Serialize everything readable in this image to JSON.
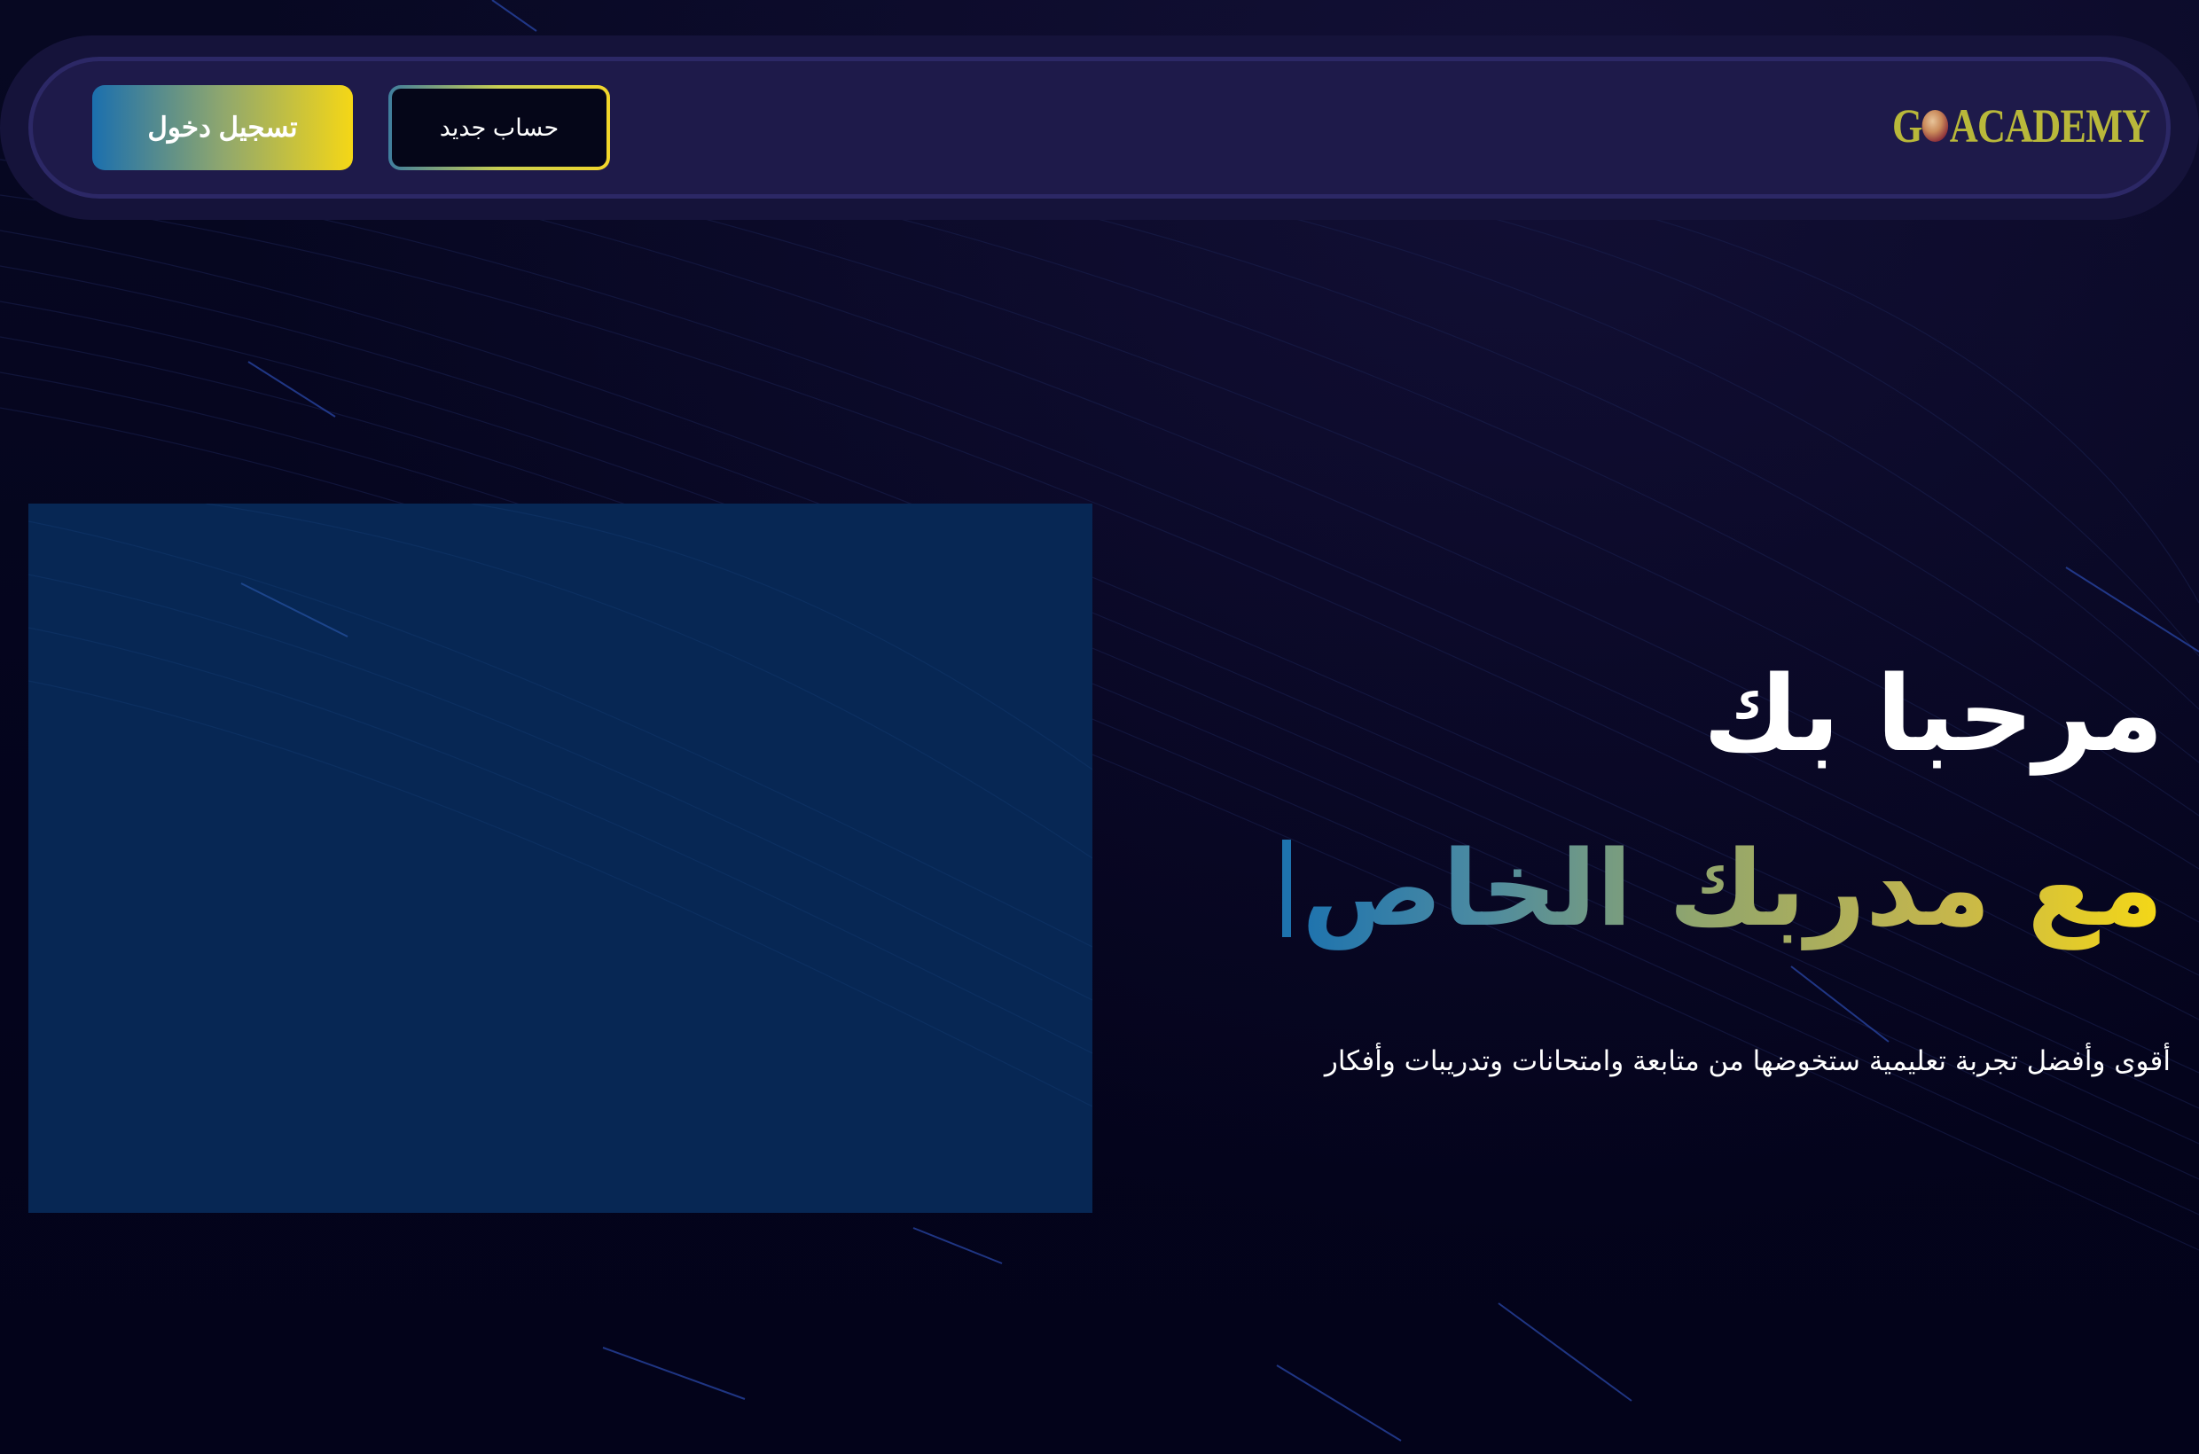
{
  "nav": {
    "logo_text": "GOACADEMY",
    "logo_left": "G",
    "logo_right": "ACADEMY",
    "login_label": "تسجيل دخول",
    "register_label": "حساب جديد"
  },
  "hero": {
    "title": "مرحبا بك",
    "subtitle": "مع مدربك الخاص",
    "description": "أقوى وأفضل تجربة تعليمية ستخوضها من متابعة وامتحانات وتدريبات وأفكار"
  },
  "colors": {
    "background": "#04041c",
    "nav": "#1e1a4a",
    "media_box": "#072754",
    "accent_yellow": "#f5d716",
    "accent_blue": "#1b6fae"
  },
  "icons": {
    "logo_ball": "soccer-ball-icon"
  }
}
